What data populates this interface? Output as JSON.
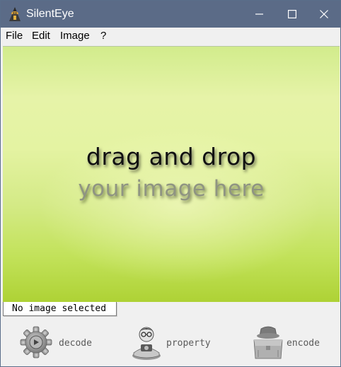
{
  "window": {
    "title": "SilentEye",
    "icon": "silenteye-app-icon"
  },
  "titlebar_buttons": {
    "minimize_icon": "minimize-icon",
    "maximize_icon": "maximize-icon",
    "close_icon": "close-icon"
  },
  "menubar": {
    "items": [
      "File",
      "Edit",
      "Image",
      "?"
    ]
  },
  "drop_area": {
    "line1": "drag and drop",
    "line2": "your image here"
  },
  "status": {
    "text": "No image selected"
  },
  "actions": {
    "decode": {
      "label": "decode",
      "icon": "decode-gear-icon"
    },
    "property": {
      "label": "property",
      "icon": "property-person-icon"
    },
    "encode": {
      "label": "encode",
      "icon": "encode-spy-icon"
    }
  },
  "colors": {
    "titlebar": "#5b6b87",
    "drop_green_light": "#e6f3a8",
    "drop_green_dark": "#aed235"
  }
}
